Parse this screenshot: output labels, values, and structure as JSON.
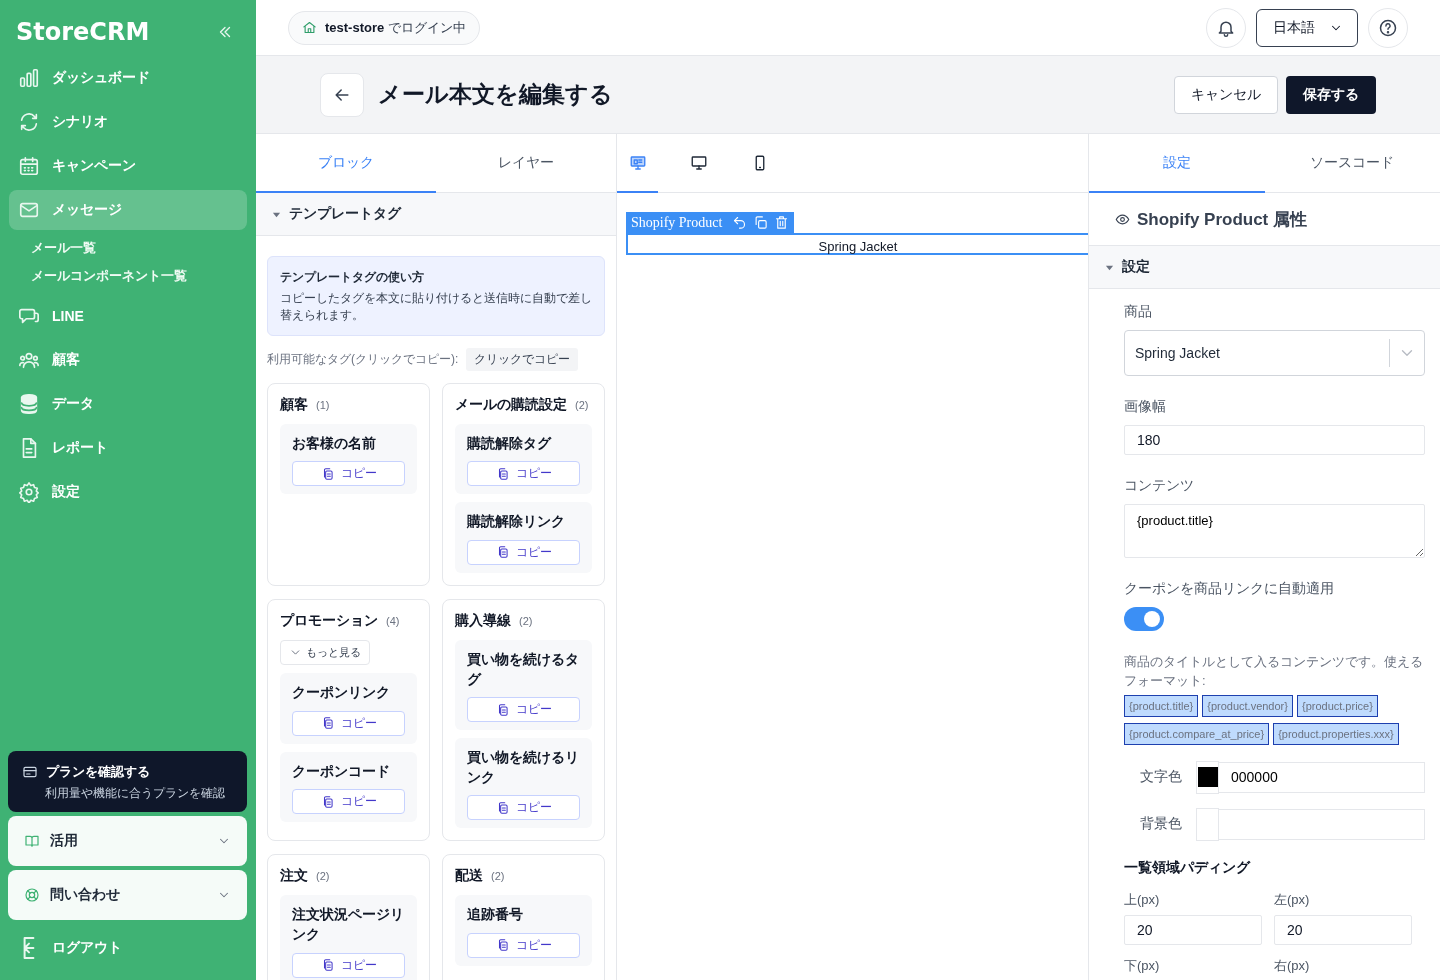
{
  "sidebar": {
    "logo": "StoreCRM",
    "nav": [
      {
        "label": "ダッシュボード",
        "selected": false
      },
      {
        "label": "シナリオ",
        "selected": false
      },
      {
        "label": "キャンペーン",
        "selected": false
      },
      {
        "label": "メッセージ",
        "selected": true,
        "children": [
          {
            "label": "メール一覧",
            "selected": false
          },
          {
            "label": "メールコンポーネント一覧",
            "selected": false
          }
        ]
      },
      {
        "label": "LINE",
        "selected": false
      },
      {
        "label": "顧客",
        "selected": false
      },
      {
        "label": "データ",
        "selected": false
      },
      {
        "label": "レポート",
        "selected": false
      },
      {
        "label": "設定",
        "selected": false
      }
    ],
    "plan": {
      "title": "プランを確認する",
      "subtitle": "利用量や機能に合うプランを確認"
    },
    "accordions": [
      {
        "label": "活用",
        "expanded": false
      },
      {
        "label": "問い合わせ",
        "expanded": false
      }
    ],
    "logout": "ログアウト"
  },
  "topbar": {
    "store": "**test-store** でログイン中",
    "language": "日本語"
  },
  "header": {
    "title": "メール本文を編集する",
    "cancel": "キャンセル",
    "save": "保存する"
  },
  "blocks_panel": {
    "tabs": [
      {
        "label": "ブロック",
        "selected": true
      },
      {
        "label": "レイヤー",
        "selected": false
      }
    ],
    "section": {
      "title": "テンプレートタグ",
      "expanded": true
    },
    "info": {
      "title": "テンプレートタグの使い方",
      "text": "コピーしたタグを本文に貼り付けると送信時に自動で差し替えられます。"
    },
    "available_label": "利用可能なタグ(クリックでコピー):",
    "hint": "クリックでコピー",
    "groups": [
      {
        "title": "顧客",
        "count": "(1)",
        "tags": [
          {
            "name": "お客様の名前",
            "action": "コピー"
          }
        ]
      },
      {
        "title": "メールの購読設定",
        "count": "(2)",
        "tags": [
          {
            "name": "購読解除タグ",
            "action": "コピー"
          },
          {
            "name": "購読解除リンク",
            "action": "コピー"
          }
        ]
      },
      {
        "title": "プロモーション",
        "count": "(4)",
        "more": "もっと見る",
        "tags": [
          {
            "name": "クーポンリンク",
            "action": "コピー"
          },
          {
            "name": "クーポンコード",
            "action": "コピー"
          }
        ]
      },
      {
        "title": "購入導線",
        "count": "(2)",
        "tags": [
          {
            "name": "買い物を続けるタグ",
            "action": "コピー"
          },
          {
            "name": "買い物を続けるリンク",
            "action": "コピー"
          }
        ]
      },
      {
        "title": "注文",
        "count": "(2)",
        "tags": [
          {
            "name": "注文状況ページリンク",
            "action": "コピー"
          }
        ]
      },
      {
        "title": "配送",
        "count": "(2)",
        "tags": [
          {
            "name": "追跡番号",
            "action": "コピー"
          }
        ]
      }
    ]
  },
  "canvas": {
    "devices": [
      {
        "selected": true
      },
      {
        "selected": false
      },
      {
        "selected": false
      }
    ],
    "block": {
      "label": "Shopify Product",
      "content": "Spring Jacket"
    }
  },
  "settings_panel": {
    "tabs": [
      {
        "label": "設定",
        "selected": true
      },
      {
        "label": "ソースコード",
        "selected": false
      }
    ],
    "title": "Shopify Product 属性",
    "section": {
      "title": "設定",
      "expanded": true
    },
    "product": {
      "label": "商品",
      "value": "Spring Jacket"
    },
    "image_width": {
      "label": "画像幅",
      "value": "180"
    },
    "content": {
      "label": "コンテンツ",
      "value": "{product.title}"
    },
    "coupon": {
      "label": "クーポンを商品リンクに自動適用",
      "on": true
    },
    "help": "商品のタイトルとして入るコンテンツです。使えるフォーマット:",
    "formats": [
      "{product.title}",
      "{product.vendor}",
      "{product.price}",
      "{product.compare_at_price}",
      "{product.properties.xxx}"
    ],
    "text_color": {
      "label": "文字色",
      "color": "#000000",
      "value": "000000"
    },
    "bg_color": {
      "label": "背景色"
    },
    "padding": {
      "title": "一覧領域パディング",
      "fields": [
        {
          "label": "上(px)",
          "value": "20"
        },
        {
          "label": "左(px)",
          "value": "20"
        },
        {
          "label": "下(px)"
        },
        {
          "label": "右(px)"
        }
      ]
    }
  }
}
